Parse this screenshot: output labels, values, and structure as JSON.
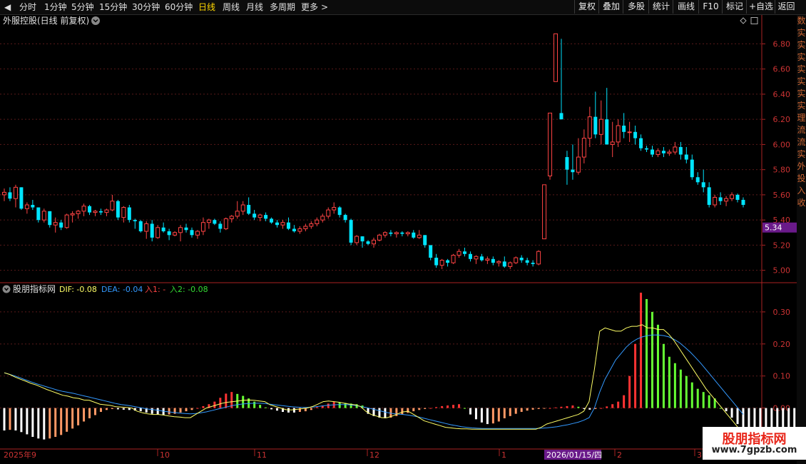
{
  "topbar": {
    "back_glyph": "◀",
    "nav": [
      "分时",
      "1分钟",
      "5分钟",
      "15分钟",
      "30分钟",
      "60分钟",
      "日线",
      "周线",
      "月线",
      "多周期",
      "更多"
    ],
    "more_glyph": ">",
    "tools": [
      "复权",
      "叠加",
      "多股",
      "统计",
      "画线",
      "F10",
      "标记",
      "+自选",
      "返回"
    ]
  },
  "main_chart": {
    "title": "外服控股(日线 前复权)",
    "price_ticks": [
      "6.80",
      "6.60",
      "6.40",
      "6.20",
      "6.00",
      "5.80",
      "5.60",
      "5.40",
      "5.20",
      "5.00"
    ],
    "current_price": "5.34"
  },
  "indicator": {
    "name": "股朋指标网",
    "dif_label": "DIF: -0.08",
    "dea_label": "DEA: -0.04",
    "in1_label": "入1: -",
    "in2_label": "入2: -0.08",
    "ticks": [
      "0.30",
      "0.20",
      "0.10",
      "0.00"
    ]
  },
  "time_axis": {
    "labels": [
      "2025年9",
      "10",
      "11",
      "12",
      "1",
      "2",
      "3"
    ],
    "selected_date": "2026/01/15/四"
  },
  "right_strip": {
    "chars": [
      "数",
      "实",
      "实",
      "实",
      "实",
      "实",
      "实",
      "实",
      "理",
      "流",
      "流",
      "实",
      "外",
      "投",
      "入",
      "收"
    ]
  },
  "watermark": {
    "title": "股朋指标网",
    "url": "www.7gpzb.com"
  },
  "colors": {
    "up": "#ff4444",
    "down": "#00e5ff",
    "axis": "#aa2222",
    "grid": "#5a1a1a",
    "dif": "#ffff66",
    "dea": "#3399ff",
    "in1": "#ff4444",
    "in2": "#33dd33",
    "selected_bg": "#6a1a8a"
  },
  "chart_data": {
    "type": "candlestick",
    "ylim": [
      4.93,
      6.95
    ],
    "candles": [
      [
        5.6,
        5.65,
        5.55,
        5.62
      ],
      [
        5.62,
        5.66,
        5.55,
        5.57
      ],
      [
        5.57,
        5.68,
        5.5,
        5.66
      ],
      [
        5.66,
        5.66,
        5.48,
        5.49
      ],
      [
        5.49,
        5.54,
        5.45,
        5.52
      ],
      [
        5.52,
        5.56,
        5.48,
        5.5
      ],
      [
        5.5,
        5.5,
        5.38,
        5.4
      ],
      [
        5.4,
        5.49,
        5.38,
        5.47
      ],
      [
        5.47,
        5.47,
        5.34,
        5.36
      ],
      [
        5.36,
        5.42,
        5.3,
        5.38
      ],
      [
        5.38,
        5.4,
        5.32,
        5.34
      ],
      [
        5.34,
        5.45,
        5.33,
        5.44
      ],
      [
        5.44,
        5.47,
        5.38,
        5.45
      ],
      [
        5.45,
        5.48,
        5.41,
        5.47
      ],
      [
        5.47,
        5.53,
        5.43,
        5.51
      ],
      [
        5.51,
        5.52,
        5.44,
        5.46
      ],
      [
        5.46,
        5.48,
        5.43,
        5.47
      ],
      [
        5.47,
        5.49,
        5.44,
        5.46
      ],
      [
        5.46,
        5.49,
        5.43,
        5.48
      ],
      [
        5.48,
        5.6,
        5.47,
        5.55
      ],
      [
        5.55,
        5.56,
        5.4,
        5.42
      ],
      [
        5.42,
        5.51,
        5.38,
        5.5
      ],
      [
        5.5,
        5.52,
        5.38,
        5.4
      ],
      [
        5.4,
        5.41,
        5.33,
        5.39
      ],
      [
        5.39,
        5.4,
        5.3,
        5.31
      ],
      [
        5.31,
        5.39,
        5.25,
        5.37
      ],
      [
        5.37,
        5.4,
        5.23,
        5.26
      ],
      [
        5.26,
        5.36,
        5.25,
        5.34
      ],
      [
        5.34,
        5.38,
        5.3,
        5.31
      ],
      [
        5.31,
        5.33,
        5.24,
        5.28
      ],
      [
        5.28,
        5.31,
        5.27,
        5.3
      ],
      [
        5.3,
        5.36,
        5.23,
        5.34
      ],
      [
        5.34,
        5.37,
        5.3,
        5.32
      ],
      [
        5.32,
        5.34,
        5.26,
        5.28
      ],
      [
        5.28,
        5.32,
        5.25,
        5.31
      ],
      [
        5.31,
        5.42,
        5.28,
        5.38
      ],
      [
        5.38,
        5.41,
        5.33,
        5.4
      ],
      [
        5.4,
        5.41,
        5.36,
        5.37
      ],
      [
        5.37,
        5.39,
        5.3,
        5.33
      ],
      [
        5.33,
        5.42,
        5.32,
        5.41
      ],
      [
        5.41,
        5.44,
        5.38,
        5.43
      ],
      [
        5.43,
        5.55,
        5.41,
        5.47
      ],
      [
        5.47,
        5.55,
        5.44,
        5.52
      ],
      [
        5.52,
        5.58,
        5.44,
        5.45
      ],
      [
        5.45,
        5.48,
        5.4,
        5.42
      ],
      [
        5.42,
        5.45,
        5.39,
        5.44
      ],
      [
        5.44,
        5.46,
        5.39,
        5.41
      ],
      [
        5.41,
        5.42,
        5.37,
        5.38
      ],
      [
        5.38,
        5.4,
        5.34,
        5.36
      ],
      [
        5.36,
        5.4,
        5.33,
        5.38
      ],
      [
        5.38,
        5.42,
        5.32,
        5.33
      ],
      [
        5.33,
        5.36,
        5.3,
        5.31
      ],
      [
        5.31,
        5.35,
        5.29,
        5.33
      ],
      [
        5.33,
        5.37,
        5.31,
        5.35
      ],
      [
        5.35,
        5.39,
        5.33,
        5.37
      ],
      [
        5.37,
        5.42,
        5.35,
        5.4
      ],
      [
        5.4,
        5.45,
        5.38,
        5.43
      ],
      [
        5.43,
        5.5,
        5.41,
        5.48
      ],
      [
        5.48,
        5.54,
        5.45,
        5.5
      ],
      [
        5.5,
        5.51,
        5.42,
        5.44
      ],
      [
        5.44,
        5.45,
        5.38,
        5.4
      ],
      [
        5.4,
        5.41,
        5.2,
        5.22
      ],
      [
        5.22,
        5.28,
        5.2,
        5.27
      ],
      [
        5.27,
        5.27,
        5.18,
        5.23
      ],
      [
        5.23,
        5.24,
        5.2,
        5.21
      ],
      [
        5.21,
        5.26,
        5.18,
        5.24
      ],
      [
        5.24,
        5.29,
        5.23,
        5.28
      ],
      [
        5.28,
        5.31,
        5.26,
        5.3
      ],
      [
        5.3,
        5.32,
        5.27,
        5.29
      ],
      [
        5.29,
        5.31,
        5.26,
        5.3
      ],
      [
        5.3,
        5.31,
        5.27,
        5.29
      ],
      [
        5.29,
        5.31,
        5.27,
        5.3
      ],
      [
        5.3,
        5.32,
        5.25,
        5.26
      ],
      [
        5.26,
        5.32,
        5.25,
        5.28
      ],
      [
        5.28,
        5.28,
        5.18,
        5.2
      ],
      [
        5.2,
        5.2,
        5.08,
        5.1
      ],
      [
        5.1,
        5.13,
        5.02,
        5.04
      ],
      [
        5.04,
        5.09,
        5.01,
        5.08
      ],
      [
        5.08,
        5.09,
        5.03,
        5.06
      ],
      [
        5.06,
        5.13,
        5.05,
        5.12
      ],
      [
        5.12,
        5.17,
        5.1,
        5.15
      ],
      [
        5.15,
        5.18,
        5.11,
        5.13
      ],
      [
        5.13,
        5.15,
        5.07,
        5.09
      ],
      [
        5.09,
        5.12,
        5.05,
        5.11
      ],
      [
        5.11,
        5.13,
        5.07,
        5.08
      ],
      [
        5.08,
        5.11,
        5.05,
        5.09
      ],
      [
        5.09,
        5.11,
        5.04,
        5.06
      ],
      [
        5.06,
        5.08,
        5.03,
        5.07
      ],
      [
        5.07,
        5.11,
        5.02,
        5.03
      ],
      [
        5.03,
        5.07,
        5.01,
        5.06
      ],
      [
        5.06,
        5.11,
        5.05,
        5.1
      ],
      [
        5.1,
        5.12,
        5.06,
        5.08
      ],
      [
        5.08,
        5.1,
        5.04,
        5.06
      ],
      [
        5.06,
        5.08,
        5.03,
        5.05
      ],
      [
        5.05,
        5.16,
        5.04,
        5.15
      ],
      [
        5.25,
        5.68,
        5.25,
        5.68
      ],
      [
        5.75,
        6.25,
        5.72,
        6.25
      ],
      [
        6.5,
        6.88,
        6.5,
        6.88
      ],
      [
        6.25,
        6.84,
        6.2,
        6.2
      ],
      [
        5.9,
        5.95,
        5.68,
        5.8
      ],
      [
        5.8,
        6.0,
        5.72,
        5.78
      ],
      [
        5.78,
        6.05,
        5.76,
        5.9
      ],
      [
        5.9,
        6.12,
        5.85,
        6.05
      ],
      [
        6.05,
        6.3,
        5.98,
        6.22
      ],
      [
        6.22,
        6.42,
        6.05,
        6.08
      ],
      [
        6.08,
        6.35,
        6.0,
        6.2
      ],
      [
        6.2,
        6.45,
        6.05,
        6.0
      ],
      [
        6.0,
        6.18,
        5.9,
        6.02
      ],
      [
        6.02,
        6.2,
        5.98,
        6.15
      ],
      [
        6.15,
        6.25,
        6.05,
        6.1
      ],
      [
        6.1,
        6.18,
        6.02,
        6.1
      ],
      [
        6.1,
        6.15,
        6.0,
        6.05
      ],
      [
        6.05,
        6.08,
        5.95,
        5.97
      ],
      [
        5.97,
        5.99,
        5.94,
        5.96
      ],
      [
        5.96,
        5.99,
        5.9,
        5.92
      ],
      [
        5.92,
        5.97,
        5.9,
        5.95
      ],
      [
        5.95,
        5.98,
        5.9,
        5.93
      ],
      [
        5.93,
        5.96,
        5.91,
        5.94
      ],
      [
        5.94,
        6.02,
        5.92,
        5.98
      ],
      [
        5.98,
        6.02,
        5.88,
        5.92
      ],
      [
        5.92,
        5.98,
        5.85,
        5.88
      ],
      [
        5.88,
        5.92,
        5.72,
        5.74
      ],
      [
        5.74,
        5.78,
        5.68,
        5.7
      ],
      [
        5.7,
        5.8,
        5.62,
        5.66
      ],
      [
        5.66,
        5.7,
        5.5,
        5.52
      ],
      [
        5.52,
        5.6,
        5.5,
        5.58
      ],
      [
        5.58,
        5.62,
        5.52,
        5.55
      ],
      [
        5.55,
        5.59,
        5.51,
        5.57
      ],
      [
        5.57,
        5.62,
        5.55,
        5.6
      ],
      [
        5.6,
        5.61,
        5.54,
        5.56
      ],
      [
        5.56,
        5.58,
        5.5,
        5.52
      ]
    ],
    "indicator_ylim": [
      -0.11,
      0.38
    ],
    "macd": [
      -0.07,
      -0.068,
      -0.07,
      -0.075,
      -0.082,
      -0.09,
      -0.095,
      -0.098,
      -0.095,
      -0.09,
      -0.084,
      -0.074,
      -0.064,
      -0.054,
      -0.042,
      -0.032,
      -0.022,
      -0.012,
      -0.006,
      -0.003,
      -0.004,
      -0.005,
      -0.006,
      -0.008,
      -0.01,
      -0.014,
      -0.018,
      -0.02,
      -0.022,
      -0.02,
      -0.018,
      -0.014,
      -0.01,
      -0.006,
      0.0,
      0.006,
      0.012,
      0.02,
      0.032,
      0.045,
      0.05,
      0.044,
      0.038,
      0.03,
      0.02,
      0.01,
      0.002,
      -0.004,
      -0.008,
      -0.012,
      -0.014,
      -0.014,
      -0.012,
      -0.01,
      -0.006,
      0.003,
      0.008,
      0.014,
      0.02,
      0.018,
      0.016,
      0.014,
      0.012,
      0.008,
      -0.018,
      -0.025,
      -0.03,
      -0.032,
      -0.03,
      -0.025,
      -0.02,
      -0.015,
      -0.01,
      -0.006,
      -0.003,
      0.0,
      0.003,
      0.006,
      0.008,
      0.01,
      0.012,
      0.0,
      -0.02,
      -0.035,
      -0.045,
      -0.05,
      -0.048,
      -0.042,
      -0.032,
      -0.025,
      -0.018,
      -0.012,
      -0.008,
      -0.005,
      -0.003,
      -0.002,
      0.0,
      0.002,
      0.004,
      0.006,
      0.008,
      0.004,
      -0.003,
      -0.005,
      -0.003,
      0.0,
      0.005,
      0.012,
      0.02,
      0.04,
      0.1,
      0.2,
      0.36,
      0.34,
      0.3,
      0.26,
      0.2,
      0.16,
      0.14,
      0.12,
      0.1,
      0.08,
      0.06,
      0.05,
      0.04,
      0.03,
      0.0,
      -0.01,
      -0.03,
      -0.05,
      -0.07,
      -0.08,
      -0.09,
      -0.095,
      -0.1,
      -0.105,
      -0.108,
      -0.11,
      -0.11,
      -0.11
    ],
    "dif_line": [
      0.11,
      0.105,
      0.097,
      0.09,
      0.084,
      0.077,
      0.072,
      0.065,
      0.058,
      0.052,
      0.046,
      0.04,
      0.037,
      0.032,
      0.03,
      0.025,
      0.024,
      0.018,
      0.012,
      0.01,
      0.008,
      0.004,
      0.003,
      0.002,
      0.0,
      -0.01,
      -0.015,
      -0.018,
      -0.02,
      -0.02,
      -0.022,
      -0.025,
      -0.027,
      -0.028,
      -0.03,
      -0.03,
      -0.02,
      -0.01,
      0.0,
      0.005,
      0.01,
      0.015,
      0.018,
      0.02,
      0.022,
      0.024,
      0.025,
      0.024,
      0.022,
      0.02,
      0.01,
      0.005,
      0.0,
      -0.005,
      -0.006,
      -0.004,
      -0.002,
      0.0,
      0.005,
      0.012,
      0.02,
      0.022,
      0.02,
      0.018,
      0.015,
      0.012,
      0.01,
      0.005,
      -0.01,
      -0.02,
      -0.025,
      -0.03,
      -0.03,
      -0.025,
      -0.018,
      -0.012,
      -0.01,
      -0.02,
      -0.03,
      -0.04,
      -0.045,
      -0.05,
      -0.055,
      -0.06,
      -0.062,
      -0.064,
      -0.065,
      -0.065,
      -0.066,
      -0.066,
      -0.066,
      -0.066,
      -0.066,
      -0.066,
      -0.066,
      -0.066,
      -0.066,
      -0.066,
      -0.066,
      -0.066,
      -0.066,
      -0.06,
      -0.05,
      -0.045,
      -0.04,
      -0.035,
      -0.03,
      -0.025,
      -0.02,
      -0.01,
      0.02,
      0.12,
      0.24,
      0.25,
      0.245,
      0.24,
      0.24,
      0.25,
      0.255,
      0.255,
      0.26,
      0.25,
      0.25,
      0.245,
      0.245,
      0.23,
      0.21,
      0.185,
      0.16,
      0.135,
      0.11,
      0.085,
      0.06,
      0.04,
      0.02,
      0.0,
      -0.02,
      -0.04,
      -0.06,
      -0.07
    ],
    "dea_line": [
      0.11,
      0.105,
      0.1,
      0.094,
      0.088,
      0.082,
      0.076,
      0.071,
      0.066,
      0.061,
      0.056,
      0.052,
      0.049,
      0.046,
      0.042,
      0.038,
      0.034,
      0.03,
      0.026,
      0.022,
      0.018,
      0.014,
      0.011,
      0.009,
      0.006,
      0.003,
      0.0,
      -0.003,
      -0.005,
      -0.007,
      -0.01,
      -0.012,
      -0.014,
      -0.016,
      -0.017,
      -0.018,
      -0.017,
      -0.015,
      -0.012,
      -0.008,
      -0.004,
      0.0,
      0.004,
      0.008,
      0.011,
      0.013,
      0.014,
      0.015,
      0.015,
      0.014,
      0.012,
      0.01,
      0.008,
      0.006,
      0.004,
      0.003,
      0.002,
      0.002,
      0.003,
      0.005,
      0.007,
      0.009,
      0.01,
      0.011,
      0.011,
      0.01,
      0.008,
      0.005,
      0.002,
      -0.002,
      -0.006,
      -0.01,
      -0.014,
      -0.017,
      -0.019,
      -0.02,
      -0.022,
      -0.025,
      -0.028,
      -0.032,
      -0.036,
      -0.04,
      -0.044,
      -0.048,
      -0.052,
      -0.055,
      -0.058,
      -0.06,
      -0.062,
      -0.063,
      -0.064,
      -0.064,
      -0.064,
      -0.064,
      -0.064,
      -0.064,
      -0.064,
      -0.064,
      -0.064,
      -0.064,
      -0.064,
      -0.063,
      -0.062,
      -0.06,
      -0.058,
      -0.055,
      -0.052,
      -0.048,
      -0.044,
      -0.038,
      -0.03,
      0.0,
      0.05,
      0.09,
      0.12,
      0.15,
      0.17,
      0.19,
      0.205,
      0.215,
      0.222,
      0.226,
      0.228,
      0.228,
      0.226,
      0.222,
      0.214,
      0.204,
      0.19,
      0.175,
      0.158,
      0.14,
      0.12,
      0.1,
      0.08,
      0.06,
      0.04,
      0.02,
      0.0,
      -0.02
    ]
  }
}
